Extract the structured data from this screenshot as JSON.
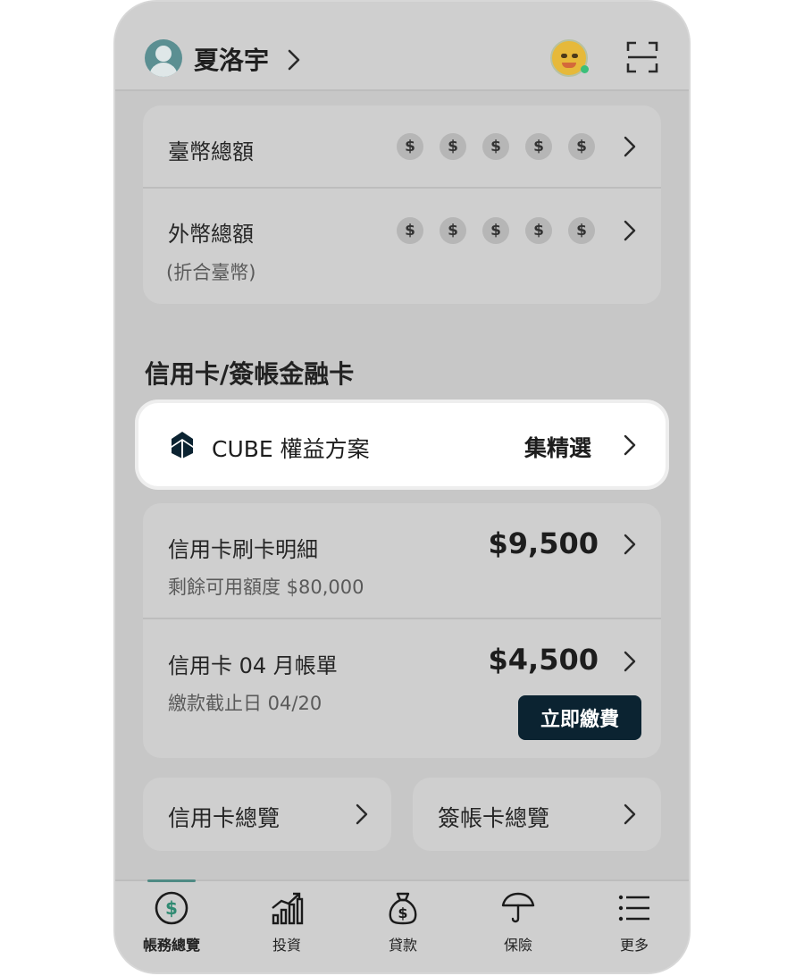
{
  "header": {
    "username": "夏洛宇"
  },
  "balances": {
    "twd": {
      "title": "臺幣總額",
      "mask": [
        "$",
        "$",
        "$",
        "$",
        "$"
      ]
    },
    "foreign": {
      "title": "外幣總額",
      "subtitle": "(折合臺幣)",
      "mask": [
        "$",
        "$",
        "$",
        "$",
        "$"
      ]
    }
  },
  "credit_section": {
    "title": "信用卡/簽帳金融卡",
    "cube": {
      "label": "CUBE 權益方案",
      "right_label": "集精選"
    },
    "transactions": {
      "title": "信用卡刷卡明細",
      "amount": "$9,500",
      "subtitle": "剩餘可用額度 $80,000"
    },
    "statement": {
      "title": "信用卡 04 月帳單",
      "amount": "$4,500",
      "subtitle": "繳款截止日 04/20",
      "pay_button": "立即繳費"
    },
    "overview_credit": "信用卡總覽",
    "overview_debit": "簽帳卡總覽"
  },
  "nav": {
    "items": [
      {
        "label": "帳務總覽",
        "icon": "dollar-circle-icon",
        "active": true
      },
      {
        "label": "投資",
        "icon": "chart-growth-icon",
        "active": false
      },
      {
        "label": "貸款",
        "icon": "money-bag-icon",
        "active": false
      },
      {
        "label": "保險",
        "icon": "umbrella-icon",
        "active": false
      },
      {
        "label": "更多",
        "icon": "menu-list-icon",
        "active": false
      }
    ]
  },
  "colors": {
    "accent": "#0b2331",
    "nav_active": "#4f8a84",
    "background": "#c7c7c7"
  }
}
